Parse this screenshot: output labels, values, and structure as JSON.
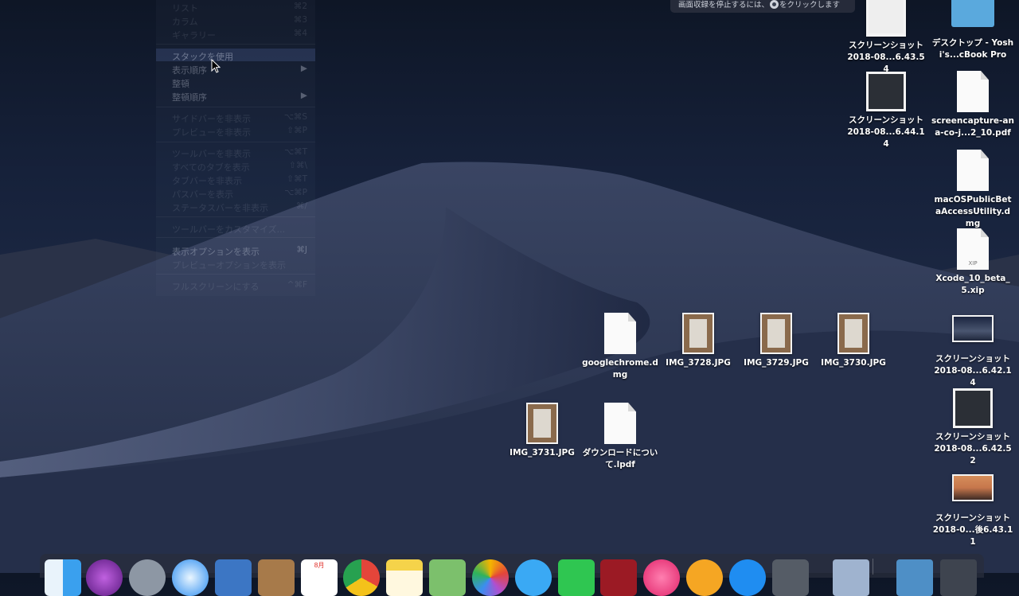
{
  "menu": {
    "items": [
      {
        "label": "リスト",
        "shortcut": "⌘2"
      },
      {
        "label": "カラム",
        "shortcut": "⌘3"
      },
      {
        "label": "ギャラリー",
        "shortcut": "⌘4"
      },
      {
        "label": "スタックを使用",
        "shortcut": ""
      },
      {
        "label": "表示順序",
        "shortcut": "▶"
      },
      {
        "label": "整頓",
        "shortcut": ""
      },
      {
        "label": "整頓順序",
        "shortcut": "▶"
      },
      {
        "label": "サイドバーを非表示",
        "shortcut": "⌥⌘S"
      },
      {
        "label": "プレビューを非表示",
        "shortcut": "⇧⌘P"
      },
      {
        "label": "ツールバーを非表示",
        "shortcut": "⌥⌘T"
      },
      {
        "label": "すべてのタブを表示",
        "shortcut": "⇧⌘\\"
      },
      {
        "label": "タブバーを非表示",
        "shortcut": "⇧⌘T"
      },
      {
        "label": "パスバーを表示",
        "shortcut": "⌥⌘P"
      },
      {
        "label": "ステータスバーを非表示",
        "shortcut": "⌘/"
      },
      {
        "label": "ツールバーをカスタマイズ...",
        "shortcut": ""
      },
      {
        "label": "表示オプションを表示",
        "shortcut": "⌘J"
      },
      {
        "label": "プレビューオプションを表示",
        "shortcut": ""
      },
      {
        "label": "フルスクリーンにする",
        "shortcut": "^⌘F"
      }
    ]
  },
  "recording_bar": {
    "text_before": "画面収録を停止するには、",
    "text_after": "をクリックします"
  },
  "desktop_icons": [
    {
      "label": "スクリーンショット 2018-08...6.43.54"
    },
    {
      "label": "デスクトップ - Yoshi's...cBook Pro"
    },
    {
      "label": "スクリーンショット 2018-08...6.44.14"
    },
    {
      "label": "screencapture-ana-co-j...2_10.pdf"
    },
    {
      "label": "macOSPublicBetaAccessUtility.dmg"
    },
    {
      "label": "Xcode_10_beta_5.xip"
    },
    {
      "label": "スクリーンショット 2018-08...6.42.14"
    },
    {
      "label": "スクリーンショット 2018-08...6.42.52"
    },
    {
      "label": "スクリーンショット 2018-0...後6.43.11"
    },
    {
      "label": "googlechrome.dmg"
    },
    {
      "label": "IMG_3728.JPG"
    },
    {
      "label": "IMG_3729.JPG"
    },
    {
      "label": "IMG_3730.JPG"
    },
    {
      "label": "IMG_3731.JPG"
    },
    {
      "label": "ダウンロードについて.lpdf"
    }
  ],
  "xip_badge": "XIP",
  "calendar_month": "8月",
  "colors": {
    "menu_highlight": "#465a8c",
    "folder": "#5aa9dd",
    "label_text": "#ffffff"
  }
}
